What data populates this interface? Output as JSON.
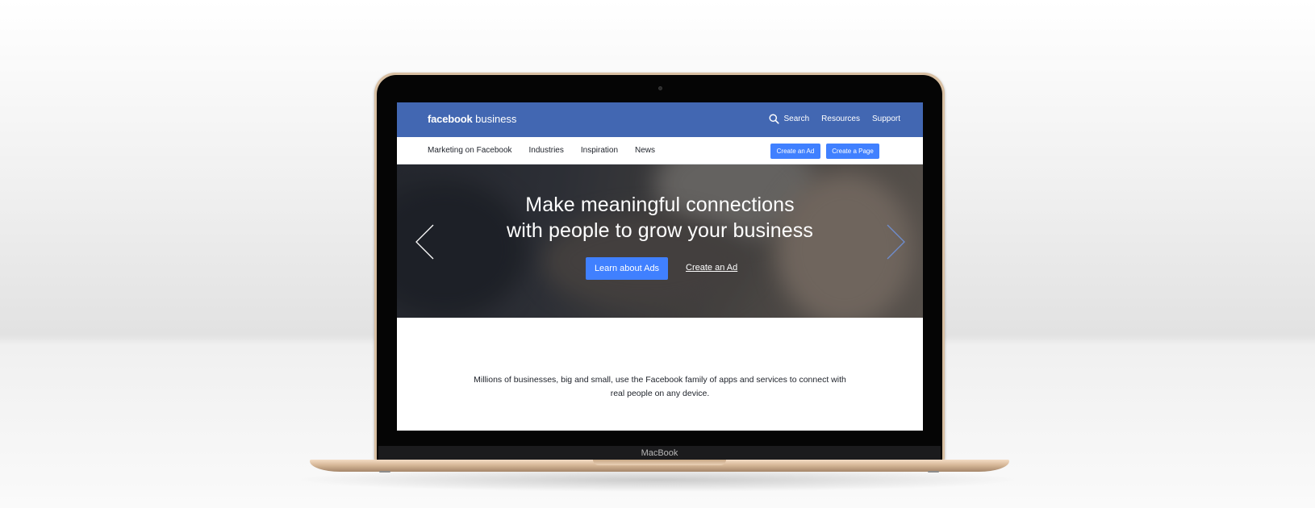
{
  "device": {
    "brand": "MacBook"
  },
  "header": {
    "logo_bold": "facebook",
    "logo_light": "business",
    "nav": {
      "search": "Search",
      "resources": "Resources",
      "support": "Support"
    }
  },
  "subnav": {
    "links": [
      "Marketing on Facebook",
      "Industries",
      "Inspiration",
      "News"
    ],
    "create_ad": "Create an Ad",
    "create_page": "Create a Page"
  },
  "hero": {
    "title_line1": "Make meaningful connections",
    "title_line2": "with people to grow your business",
    "primary_cta": "Learn about Ads",
    "secondary_cta": "Create an Ad"
  },
  "intro": {
    "line1": "Millions of businesses, big and small, use the Facebook family of apps and services to connect with",
    "line2": "real people on any device."
  },
  "colors": {
    "facebook_blue": "#4267b2",
    "button_blue": "#4080ff"
  },
  "icons": {
    "search": "search-icon",
    "prev": "chevron-left-icon",
    "next": "chevron-right-icon"
  }
}
